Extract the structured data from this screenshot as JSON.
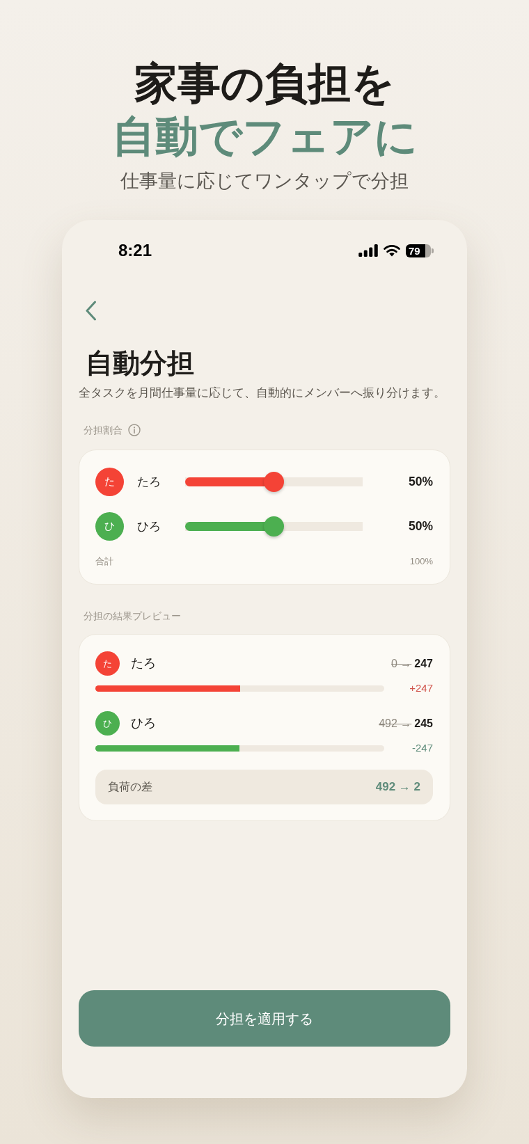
{
  "headline": {
    "line_1": "家事の負担を",
    "line_2": "自動でフェアに",
    "subtitle": "仕事量に応じてワンタップで分担"
  },
  "status_bar": {
    "time": "8:21",
    "battery": "79"
  },
  "screen": {
    "title": "自動分担",
    "description": "全タスクを月間仕事量に応じて、自動的にメンバーへ振り分けます。"
  },
  "share_ratio": {
    "label": "分担割合",
    "members": [
      {
        "initial": "た",
        "name": "たろ",
        "color": "#f44336",
        "level": 0.5,
        "reading": "50%"
      },
      {
        "initial": "ひ",
        "name": "ひろ",
        "color": "#4caf50",
        "level": 0.5,
        "reading": "50%"
      }
    ],
    "total_label": "合計",
    "total_value": "100%"
  },
  "preview": {
    "label": "分担の結果プレビュー",
    "members": [
      {
        "kind": "increase",
        "initial": "た",
        "name": "たろ",
        "color": "#f44336",
        "before": "0 →",
        "after": "247",
        "level": 0.502,
        "change": "+247"
      },
      {
        "kind": "decrease",
        "initial": "ひ",
        "name": "ひろ",
        "color": "#4caf50",
        "before": "492 →",
        "after": "245",
        "level": 0.498,
        "change": "-247"
      }
    ],
    "difference": {
      "label": "負荷の差",
      "value": "492 → 2"
    }
  },
  "apply_button": "分担を適用する"
}
